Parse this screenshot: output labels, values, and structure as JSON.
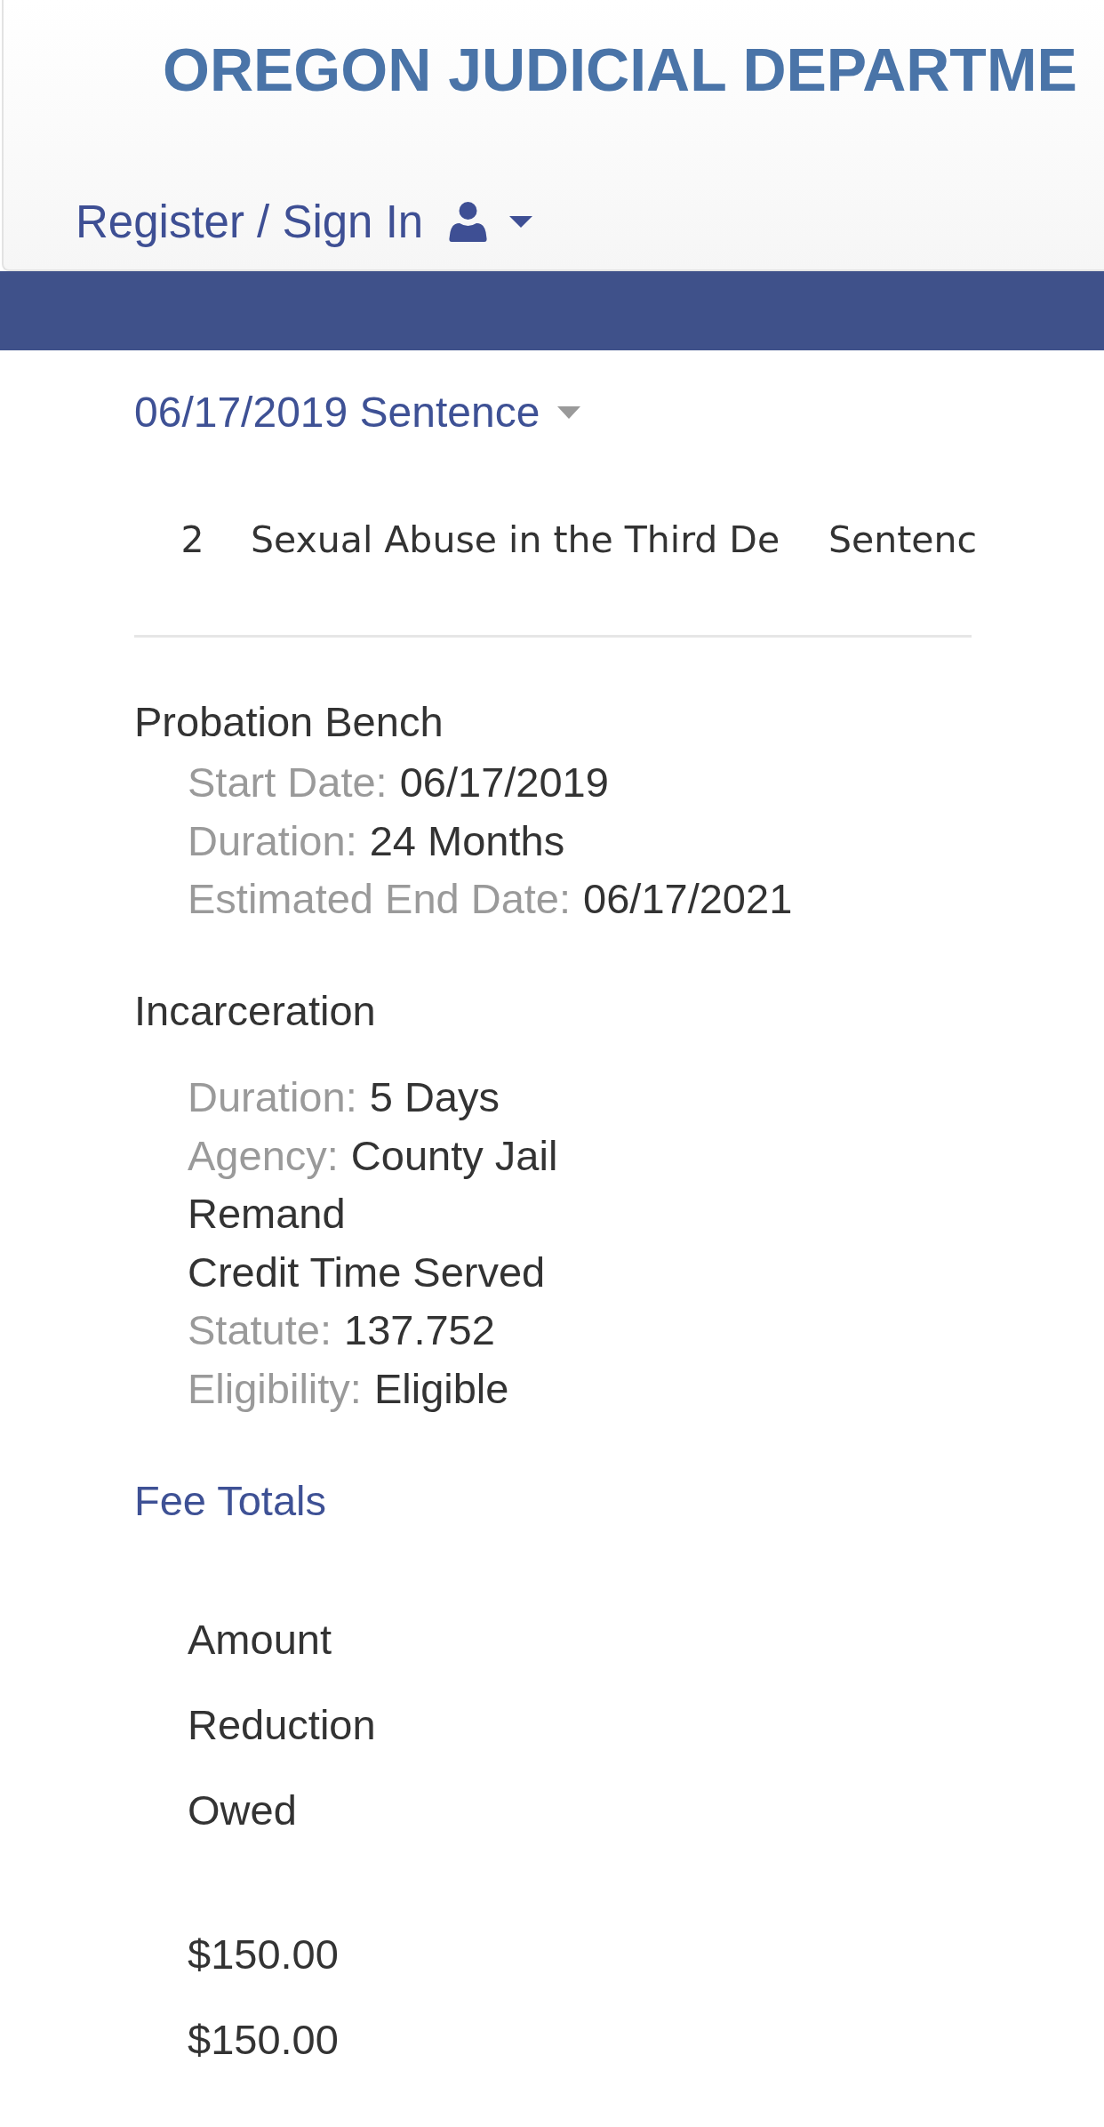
{
  "header": {
    "title": "OREGON JUDICIAL DEPARTME",
    "account_link": "Register / Sign In"
  },
  "sentence": {
    "title": "06/17/2019 Sentence"
  },
  "charges_table": {
    "rows": [
      {
        "cells": [
          "2",
          "Sexual Abuse in the Third De",
          "Sentenc"
        ]
      }
    ]
  },
  "probation": {
    "title": "Probation Bench",
    "fields": [
      {
        "kind": "pair",
        "label": "Start Date:",
        "value": "06/17/2019"
      },
      {
        "kind": "pair",
        "label": "Duration:",
        "value": "24 Months"
      },
      {
        "kind": "pair",
        "label": "Estimated End Date:",
        "value": "06/17/2021"
      }
    ]
  },
  "incarceration": {
    "title": "Incarceration",
    "fields": [
      {
        "kind": "pair",
        "label": "Duration:",
        "value": "5 Days"
      },
      {
        "kind": "pair",
        "label": "Agency:",
        "value": "County Jail"
      },
      {
        "kind": "note",
        "value": "Remand"
      },
      {
        "kind": "note",
        "value": "Credit Time Served"
      },
      {
        "kind": "pair",
        "label": "Statute:",
        "value": "137.752"
      },
      {
        "kind": "pair",
        "label": "Eligibility:",
        "value": "Eligible"
      }
    ]
  },
  "fee_totals": {
    "title": "Fee Totals",
    "headers": [
      "Amount",
      "Reduction",
      "Owed"
    ],
    "values": [
      "$150.00",
      "$150.00"
    ]
  }
}
